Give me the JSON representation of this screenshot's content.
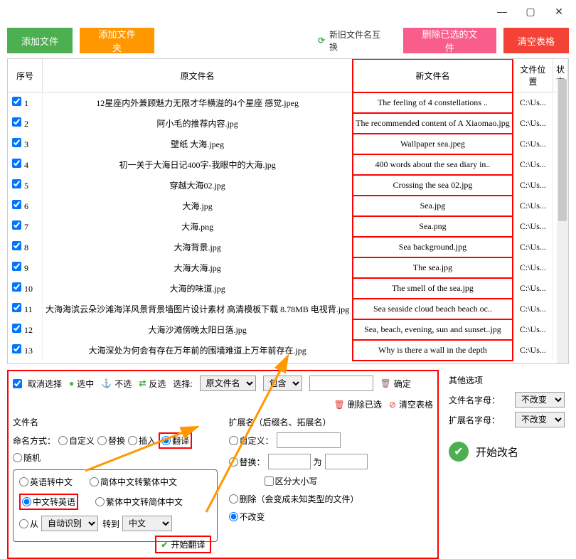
{
  "titlebar": {
    "min": "—",
    "max": "▢",
    "close": "✕"
  },
  "toolbar": {
    "add_file": "添加文件",
    "add_folder": "添加文件夹",
    "swap": "新旧文件名互换",
    "del_selected": "删除已选的文件",
    "clear_table": "清空表格"
  },
  "table": {
    "headers": {
      "seq": "序号",
      "old": "原文件名",
      "new": "新文件名",
      "loc": "文件位置",
      "status": "状态"
    },
    "rows": [
      {
        "n": "1",
        "old": "12星座内外兼顾魅力无限才华横溢的4个星座 感觉.jpeg",
        "new": "The feeling of 4 constellations ..",
        "loc": "C:\\Us..."
      },
      {
        "n": "2",
        "old": "阿小毛的推荐内容.jpg",
        "new": "The recommended content of A Xiaomao.jpg",
        "loc": "C:\\Us..."
      },
      {
        "n": "3",
        "old": "壁纸 大海.jpeg",
        "new": "Wallpaper sea.jpeg",
        "loc": "C:\\Us..."
      },
      {
        "n": "4",
        "old": "初一关于大海日记400字-我眼中的大海.jpg",
        "new": "400 words about the sea diary in..",
        "loc": "C:\\Us..."
      },
      {
        "n": "5",
        "old": "穿越大海02.jpg",
        "new": "Crossing the sea 02.jpg",
        "loc": "C:\\Us..."
      },
      {
        "n": "6",
        "old": "大海.jpg",
        "new": "Sea.jpg",
        "loc": "C:\\Us..."
      },
      {
        "n": "7",
        "old": "大海.png",
        "new": "Sea.png",
        "loc": "C:\\Us..."
      },
      {
        "n": "8",
        "old": "大海背景.jpg",
        "new": "Sea background.jpg",
        "loc": "C:\\Us..."
      },
      {
        "n": "9",
        "old": "大海大海.jpg",
        "new": "The sea.jpg",
        "loc": "C:\\Us..."
      },
      {
        "n": "10",
        "old": "大海的味道.jpg",
        "new": "The smell of the sea.jpg",
        "loc": "C:\\Us..."
      },
      {
        "n": "11",
        "old": "大海海滨云朵沙滩海洋风景背景墙图片设计素材 高清模板下载 8.78MB 电视背.jpg",
        "new": "Sea seaside cloud beach beach oc..",
        "loc": "C:\\Us..."
      },
      {
        "n": "12",
        "old": "大海沙滩傍晚太阳日落.jpg",
        "new": "Sea, beach, evening, sun and sunset..jpg",
        "loc": "C:\\Us..."
      },
      {
        "n": "13",
        "old": "大海深处为何会有存在万年前的围墙难道上万年前存在.jpg",
        "new": "Why is there a wall in the depth",
        "loc": "C:\\Us..."
      }
    ]
  },
  "selbar": {
    "cancel_sel": "取消选择",
    "select_all": "选中",
    "deselect": "不选",
    "invert": "反选",
    "label_select": "选择:",
    "dd_source": "原文件名",
    "dd_contains": "包含",
    "confirm": "确定",
    "del_sel": "删除已选",
    "clear_tbl": "清空表格"
  },
  "filename": {
    "section": "文件名",
    "method_label": "命名方式：",
    "opt_custom": "自定义",
    "opt_replace": "替换",
    "opt_insert": "插入",
    "opt_translate": "翻译",
    "opt_random": "随机",
    "trans_en2cn": "英语转中文",
    "trans_s2t": "简体中文转繁体中文",
    "trans_cn2en": "中文转英语",
    "trans_t2s": "繁体中文转简体中文",
    "from_label": "从",
    "from_auto": "自动识别",
    "to_label": "转到",
    "to_lang": "中文",
    "start_translate": "开始翻译"
  },
  "ext": {
    "section": "扩展名（后缀名、拓展名）",
    "opt_custom": "自定义：",
    "opt_replace": "替换：",
    "to": "为",
    "case_sensitive": "区分大小写",
    "opt_delete": "删除（会变成未知类型的文件）",
    "opt_keep": "不改变"
  },
  "other": {
    "section": "其他选项",
    "opt_fname_case": "文件名字母：",
    "opt_ext_case": "扩展名字母：",
    "val_nochange": "不改变"
  },
  "start_rename": "开始改名"
}
